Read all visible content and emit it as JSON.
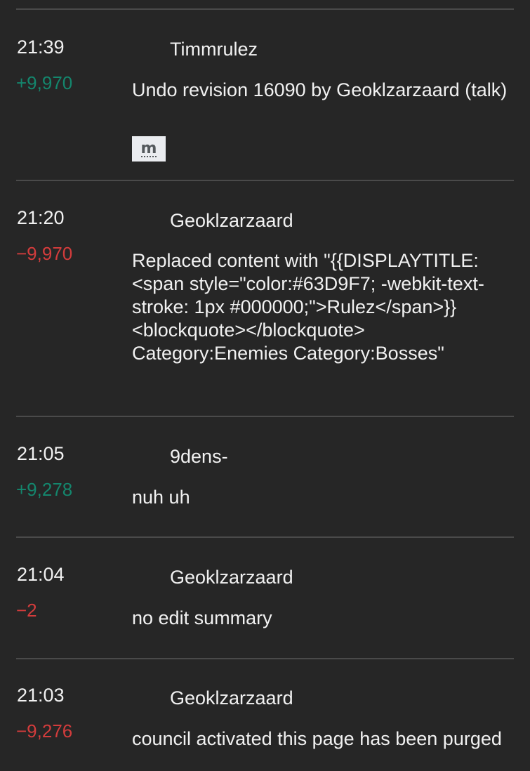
{
  "history": {
    "entries": [
      {
        "time": "21:39",
        "user": "Timmrulez",
        "bytes": "+9,970",
        "bytes_sign": "pos",
        "summary": "Undo revision 16090 by Geoklzarzaard (talk)",
        "minor_label": "m"
      },
      {
        "time": "21:20",
        "user": "Geoklzarzaard",
        "bytes": "−9,970",
        "bytes_sign": "neg",
        "summary": "Replaced content with \"{{DISPLAYTITLE:<span style=\"color:#63D9F7; -webkit-text-stroke: 1px #000000;\">Rulez</span>}} <blockquote></blockquote> Category:Enemies Category:Bosses\""
      },
      {
        "time": "21:05",
        "user": "9dens-",
        "bytes": "+9,278",
        "bytes_sign": "pos",
        "summary": "nuh uh"
      },
      {
        "time": "21:04",
        "user": "Geoklzarzaard",
        "bytes": "−2",
        "bytes_sign": "neg",
        "summary": "no edit summary"
      },
      {
        "time": "21:03",
        "user": "Geoklzarzaard",
        "bytes": "−9,276",
        "bytes_sign": "neg",
        "summary": "council activated this page has been purged"
      }
    ],
    "colors": {
      "positive": "#14866d",
      "negative": "#d33c3c",
      "background": "#262626"
    }
  }
}
